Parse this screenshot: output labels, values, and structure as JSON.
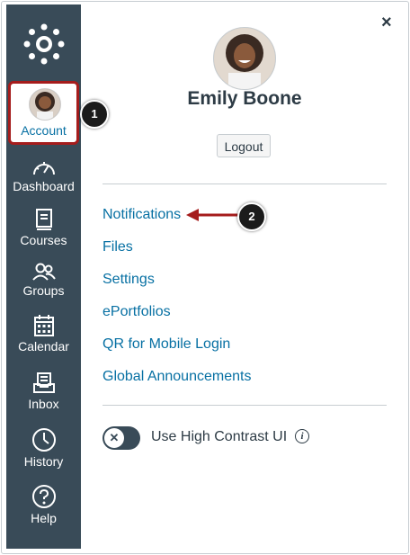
{
  "nav": {
    "account": "Account",
    "dashboard": "Dashboard",
    "courses": "Courses",
    "groups": "Groups",
    "calendar": "Calendar",
    "inbox": "Inbox",
    "history": "History",
    "help": "Help"
  },
  "tray": {
    "close_glyph": "×",
    "user_name": "Emily Boone",
    "logout_label": "Logout",
    "links": [
      "Notifications",
      "Files",
      "Settings",
      "ePortfolios",
      "QR for Mobile Login",
      "Global Announcements"
    ],
    "toggle_label": "Use High Contrast UI",
    "toggle_glyph": "✕",
    "info_glyph": "i"
  },
  "callouts": [
    "1",
    "2"
  ],
  "colors": {
    "sidebar": "#394b58",
    "link": "#0770a3",
    "highlight_border": "#a51c1c",
    "arrow": "#a51c1c"
  },
  "icons": [
    "canvas-logo-icon",
    "dashboard-icon",
    "courses-icon",
    "groups-icon",
    "calendar-icon",
    "inbox-icon",
    "history-icon",
    "help-icon",
    "info-icon",
    "arrow-icon"
  ]
}
